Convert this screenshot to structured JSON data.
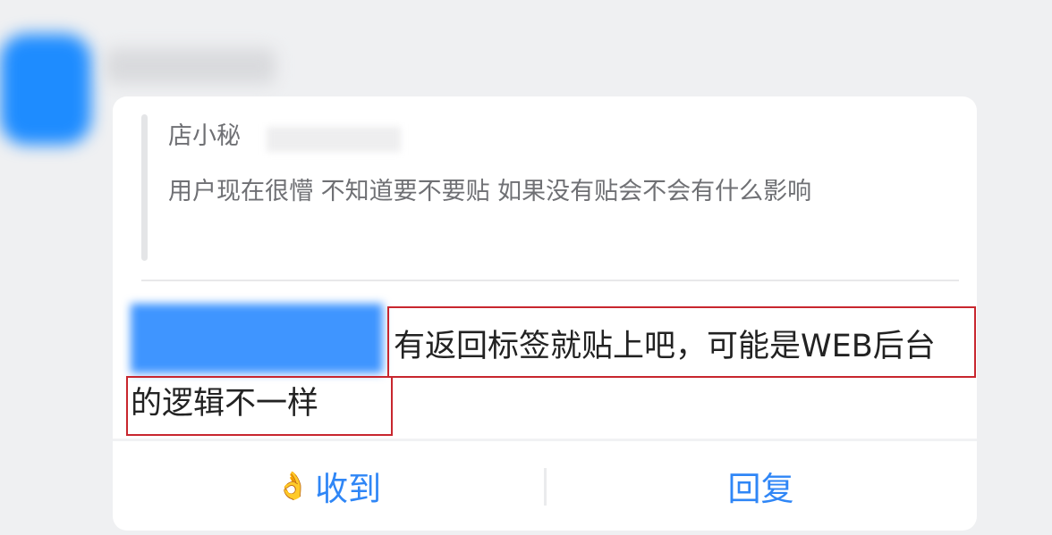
{
  "quote": {
    "author": "店小秘",
    "text": "用户现在很懵  不知道要不要贴  如果没有贴会不会有什么影响"
  },
  "reply": {
    "text": "有返回标签就贴上吧，可能是WEB后台的逻辑不一样"
  },
  "actions": {
    "receive_icon": "👌",
    "receive_label": "收到",
    "reply_label": "回复"
  },
  "colors": {
    "accent": "#2f86f6",
    "highlight_border": "#c8262e",
    "background": "#eff0f2",
    "card": "#ffffff"
  }
}
